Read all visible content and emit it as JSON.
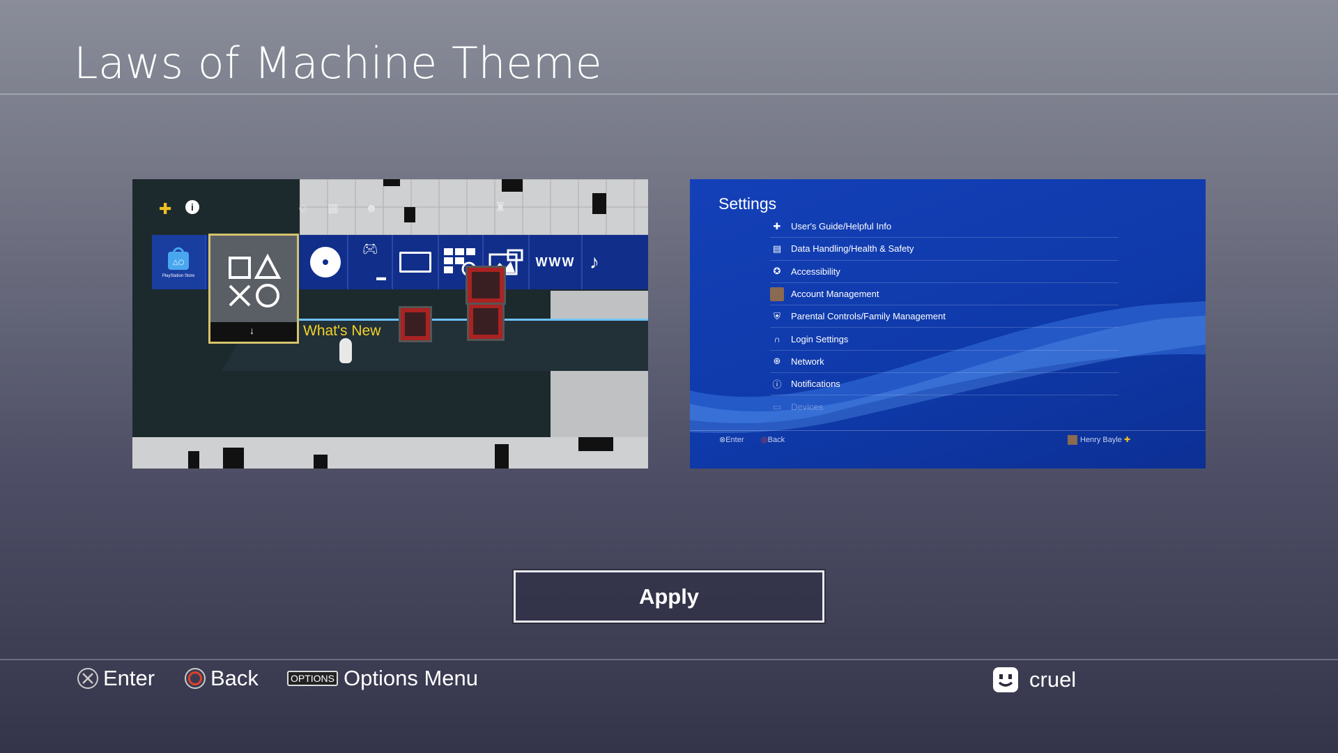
{
  "header": {
    "title": "Laws of Machine Theme"
  },
  "preview_home": {
    "store_label": "PlayStation Store",
    "whats_new": "What's New",
    "tile_icons": [
      "playstation-store-icon",
      "ps-shapes-icon",
      "disc-icon",
      "controller-icon",
      "folder-icon",
      "tv-icon",
      "tv-video-icon",
      "gallery-icon",
      "internet-browser-icon",
      "music-icon"
    ],
    "top_icons": [
      "ps-plus-icon",
      "info-icon",
      "friends-icon",
      "messages-icon",
      "face-icon",
      "trophy-icon"
    ],
    "www_label": "WWW"
  },
  "preview_settings": {
    "title": "Settings",
    "items": [
      {
        "label": "User's Guide/Helpful Info",
        "icon": "guide-icon"
      },
      {
        "label": "Data Handling/Health & Safety",
        "icon": "data-icon"
      },
      {
        "label": "Accessibility",
        "icon": "accessibility-icon"
      },
      {
        "label": "Account Management",
        "icon": "account-avatar-icon"
      },
      {
        "label": "Parental Controls/Family Management",
        "icon": "shield-icon"
      },
      {
        "label": "Login Settings",
        "icon": "login-icon"
      },
      {
        "label": "Network",
        "icon": "globe-icon"
      },
      {
        "label": "Notifications",
        "icon": "info-icon"
      },
      {
        "label": "Devices",
        "icon": "devices-icon"
      }
    ],
    "footer_enter": "Enter",
    "footer_back": "Back",
    "footer_user": "Henry Bayle"
  },
  "apply_button": {
    "label": "Apply"
  },
  "footer": {
    "enter": "Enter",
    "back": "Back",
    "options_tag": "OPTIONS",
    "options_menu": "Options Menu",
    "user": "cruel"
  },
  "colors": {
    "settings_blue": "#1440b8",
    "whats_new_yellow": "#f2d22a",
    "focus_border": "#d6c36a",
    "back_red": "#e0402a"
  }
}
